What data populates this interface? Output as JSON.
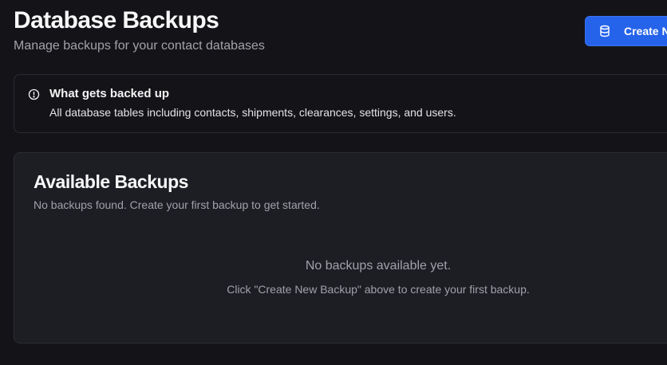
{
  "header": {
    "title": "Database Backups",
    "subtitle": "Manage backups for your contact databases",
    "create_button_label": "Create New Backup",
    "create_button_icon": "database-icon"
  },
  "info": {
    "icon": "info-circle-icon",
    "title": "What gets backed up",
    "description": "All database tables including contacts, shipments, clearances, settings, and users."
  },
  "backups": {
    "title": "Available Backups",
    "description": "No backups found. Create your first backup to get started.",
    "empty_title": "No backups available yet.",
    "empty_hint": "Click \"Create New Backup\" above to create your first backup."
  },
  "colors": {
    "background": "#141418",
    "card": "#1d1e23",
    "border": "#2b2c33",
    "accent": "#2563eb",
    "muted_text": "#a1a1aa"
  }
}
